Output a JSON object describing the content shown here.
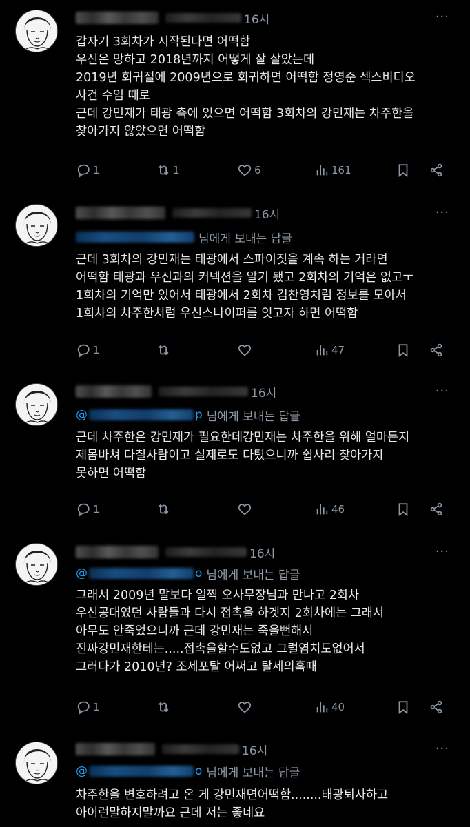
{
  "posts": [
    {
      "time": "16시",
      "more": "···",
      "handle_partial": "",
      "lines": [
        "갑자기 3회차가 시작된다면 어떡함",
        "우신은 망하고 2018년까지 어떻게 잘 살았는데",
        "2019년 회귀절에 2009년으로 회귀하면 어떡함 정영준 섹스비디오",
        "사건 수임 때로",
        "근데 강민재가 태광 측에 있으면 어떡함 3회차의 강민재는 차주한을",
        "찾아가지 않았으면 어떡함"
      ],
      "stats": {
        "replies": "1",
        "reposts": "1",
        "likes": "6",
        "views": "161"
      }
    },
    {
      "time": "16시",
      "more": "···",
      "reply_to": "님에게 보내는 답글",
      "lines": [
        "근데 3회차의 강민재는 태광에서 스파이짓을 계속 하는 거라면",
        "어떡함 태광과 우신과의 커넥션을 알기 됐고 2회차의 기억은 없고ㅜ",
        "1회차의 기억만 있어서 태광에서 2회차 김찬영처럼 정보를 모아서",
        "1회차의 차주한처럼 우신스나이퍼를 잇고자 하면 어떡함"
      ],
      "stats": {
        "replies": "1",
        "reposts": "",
        "likes": "",
        "views": "47"
      }
    },
    {
      "time": "16시",
      "more": "···",
      "reply_to": "님에게 보내는 답글",
      "mention_prefix": "@",
      "mention_suffix": "p",
      "lines": [
        "근데 차주한은 강민재가 필요한데강민재는 차주한을  위해 얼마든지",
        "제몸바쳐 다칠사람이고 실제로도 다텼으니까 쉽사리 찾아가지",
        "못하면 어떡함"
      ],
      "stats": {
        "replies": "1",
        "reposts": "",
        "likes": "",
        "views": "46"
      }
    },
    {
      "time": "16시",
      "more": "···",
      "reply_to": "님에게 보내는 답글",
      "mention_prefix": "@",
      "mention_suffix": "o",
      "lines": [
        "그래서 2009년 말보다 일찍 오사무장님과 만나고 2회차",
        "우신공대였던 사람들과 다시 접촉을 하겟지 2회차에는 그래서",
        "아무도 안죽었으니까 근데 강민재는 죽을뻔해서",
        "진짜강민재한테는.....접촉을할수도없고 그럴염치도없어서",
        "그러다가 2010년? 조세포탈 어쩌고 탈세의혹때"
      ],
      "stats": {
        "replies": "1",
        "reposts": "",
        "likes": "",
        "views": "40"
      }
    },
    {
      "time": "16시",
      "more": "···",
      "reply_to": "님에게 보내는 답글",
      "mention_prefix": "@",
      "mention_suffix": "o",
      "lines": [
        "차주한을 변호하려고 온 게 강민재면어떡함........태광퇴사하고",
        "아이런말하지말까요 근데 저는 좋네요"
      ],
      "stats": {}
    }
  ],
  "icons": {
    "reply": "reply-icon",
    "repost": "repost-icon",
    "like": "heart-icon",
    "views": "views-icon",
    "bookmark": "bookmark-icon",
    "share": "share-icon",
    "avatar": "avatar-illustration"
  },
  "colors": {
    "background": "#000000",
    "text": "#e7e9ea",
    "muted": "#8b98a5",
    "link": "#1d9bf0"
  }
}
